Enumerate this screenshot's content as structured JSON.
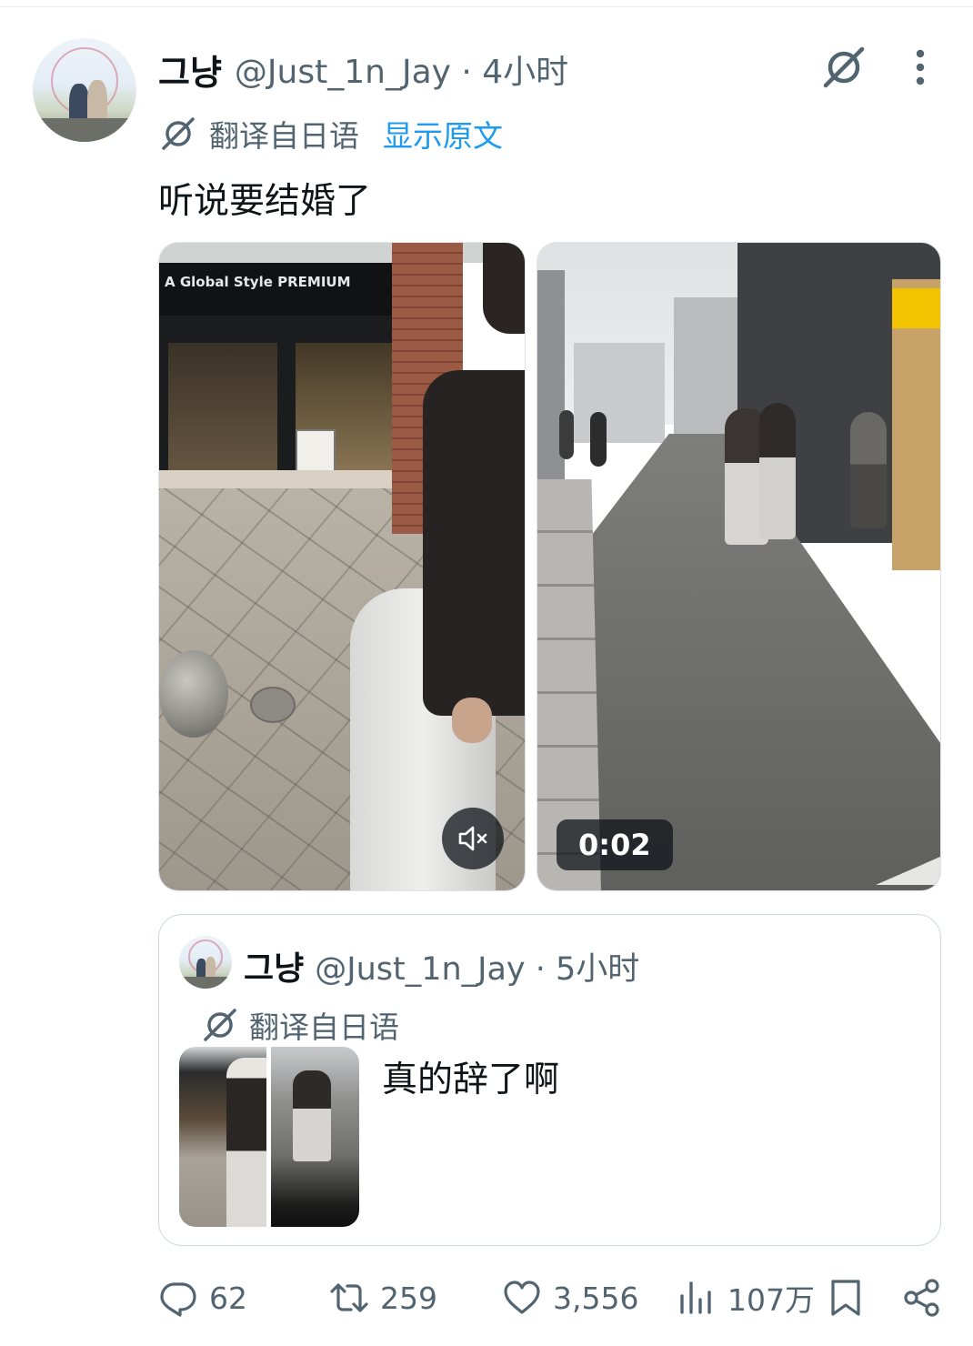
{
  "post": {
    "display_name": "그냥",
    "handle_time": "@Just_1n_Jay · 4小时",
    "translated_label": "翻译自日语",
    "show_original": "显示原文",
    "text": "听说要结婚了",
    "media": {
      "left_store_sign": "A Global Style PREMIUM",
      "video_duration": "0:02",
      "mute_icon": "speaker-muted-icon"
    }
  },
  "quoted_post": {
    "display_name": "그냥",
    "handle_time": "@Just_1n_Jay · 5小时",
    "translated_label": "翻译自日语",
    "text": "真的辞了啊"
  },
  "actions": {
    "replies": "62",
    "reposts": "259",
    "likes": "3,556",
    "views": "107万"
  },
  "colors": {
    "text_primary": "#0f1419",
    "text_secondary": "#536471",
    "link_blue": "#1d9bf0",
    "border": "#cfd9de"
  }
}
